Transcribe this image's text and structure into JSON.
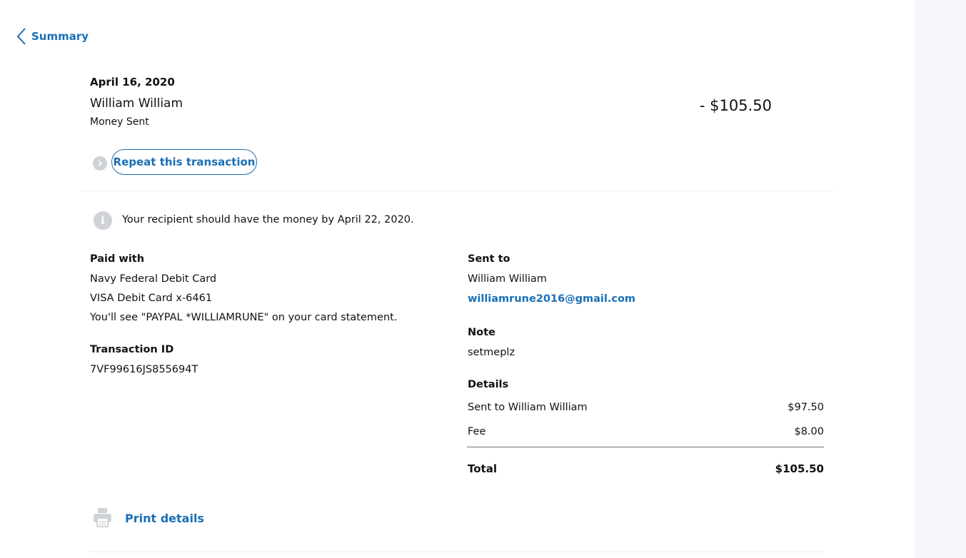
{
  "nav": {
    "back_label": "Summary"
  },
  "transaction": {
    "date": "April 16, 2020",
    "counterparty": "William William",
    "type": "Money Sent",
    "amount": "- $105.50",
    "repeat_label": "Repeat this transaction"
  },
  "notice": {
    "icon": "info-icon",
    "text": "Your recipient should have the money by April 22, 2020."
  },
  "paid_with": {
    "heading": "Paid with",
    "source": "Navy Federal Debit Card",
    "card": "VISA Debit Card x-6461",
    "statement_note": "You'll see \"PAYPAL *WILLIAMRUNE\" on your card statement."
  },
  "transaction_id": {
    "heading": "Transaction ID",
    "value": "7VF99616JS855694T"
  },
  "sent_to": {
    "heading": "Sent to",
    "name": "William William",
    "email": "williamrune2016@gmail.com"
  },
  "note": {
    "heading": "Note",
    "value": "setmeplz"
  },
  "details": {
    "heading": "Details",
    "rows": [
      {
        "label": "Sent to William William",
        "value": "$97.50"
      },
      {
        "label": "Fee",
        "value": "$8.00"
      }
    ],
    "total_label": "Total",
    "total_value": "$105.50"
  },
  "print": {
    "label": "Print details",
    "icon": "printer-icon"
  },
  "colors": {
    "link": "#1a6fb5",
    "text": "#111111",
    "icon_gray": "#cfd3d7",
    "side_rail": "#f5f7fa"
  }
}
